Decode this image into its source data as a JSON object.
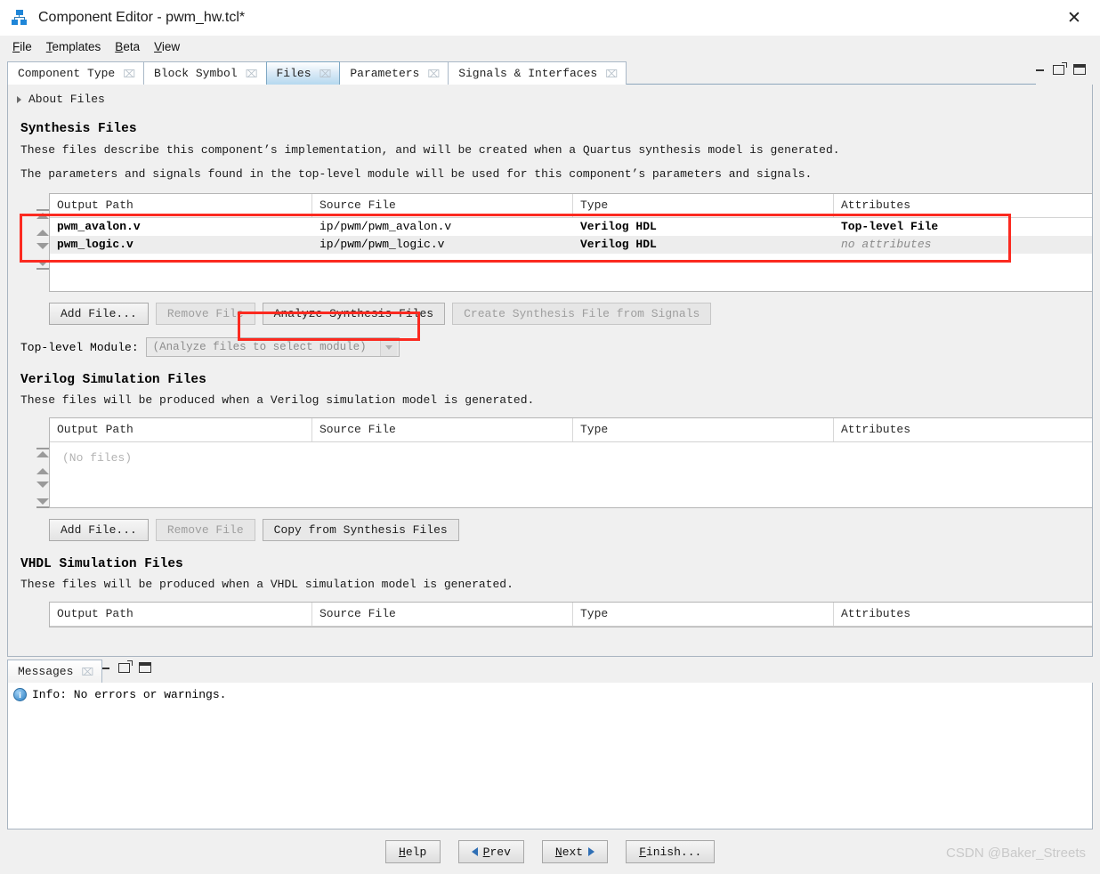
{
  "window": {
    "title": "Component Editor - pwm_hw.tcl*",
    "app_icon": "hierarchy-icon",
    "close_label": "✕"
  },
  "menubar": {
    "items": [
      {
        "pre": "F",
        "rest": "ile"
      },
      {
        "pre": "T",
        "rest": "emplates"
      },
      {
        "pre": "B",
        "rest": "eta"
      },
      {
        "pre": "V",
        "rest": "iew"
      }
    ]
  },
  "tabs": {
    "items": [
      {
        "label": "Component Type",
        "selected": false
      },
      {
        "label": "Block Symbol",
        "selected": false
      },
      {
        "label": "Files",
        "selected": true
      },
      {
        "label": "Parameters",
        "selected": false
      },
      {
        "label": "Signals & Interfaces",
        "selected": false
      }
    ],
    "close_glyph": "⌧",
    "panel_controls": [
      "minimize-icon",
      "float-icon",
      "restore-icon"
    ]
  },
  "about": {
    "label": "About Files",
    "expander": "chevron-right-icon"
  },
  "synthesis": {
    "title": "Synthesis Files",
    "desc1": "These files describe this component’s implementation, and will be created when a Quartus synthesis model is generated.",
    "desc2": "The parameters and signals found in the top-level module will be used for this component’s parameters and signals.",
    "columns": [
      "Output Path",
      "Source File",
      "Type",
      "Attributes"
    ],
    "rows": [
      {
        "output_path": "pwm_avalon.v",
        "source_file": "ip/pwm/pwm_avalon.v",
        "type": "Verilog HDL",
        "attributes": "Top-level File"
      },
      {
        "output_path": "pwm_logic.v",
        "source_file": "ip/pwm/pwm_logic.v",
        "type": "Verilog HDL",
        "attributes": "no attributes"
      }
    ],
    "buttons": [
      {
        "label": "Add File...",
        "enabled": true
      },
      {
        "label": "Remove File",
        "enabled": false
      },
      {
        "label": "Analyze Synthesis Files",
        "enabled": true,
        "highlighted": true
      },
      {
        "label": "Create Synthesis File from Signals",
        "enabled": false
      }
    ],
    "toplevel_label": "Top-level Module:",
    "toplevel_value": "(Analyze files to select module)"
  },
  "verilog_sim": {
    "title": "Verilog Simulation Files",
    "desc": "These files will be produced when a Verilog simulation model is generated.",
    "columns": [
      "Output Path",
      "Source File",
      "Type",
      "Attributes"
    ],
    "empty_text": "(No files)",
    "buttons": [
      {
        "label": "Add File...",
        "enabled": true
      },
      {
        "label": "Remove File",
        "enabled": false
      },
      {
        "label": "Copy from Synthesis Files",
        "enabled": true
      }
    ]
  },
  "vhdl_sim": {
    "title": "VHDL Simulation Files",
    "desc": "These files will be produced when a VHDL simulation model is generated.",
    "columns": [
      "Output Path",
      "Source File",
      "Type",
      "Attributes"
    ]
  },
  "messages": {
    "tab_label": "Messages",
    "close_glyph": "⌧",
    "info_glyph": "i",
    "text": "Info: No errors or warnings.",
    "panel_controls": [
      "minimize-icon",
      "float-icon",
      "restore-icon"
    ]
  },
  "footer": {
    "help": {
      "pre": "H",
      "rest": "elp"
    },
    "prev": {
      "pre": "P",
      "rest": "rev"
    },
    "next": {
      "pre": "N",
      "rest": "ext"
    },
    "finish": {
      "pre": "F",
      "rest": "inish..."
    }
  },
  "watermark": "CSDN @Baker_Streets",
  "colors": {
    "accent_tab": "#b5d8ef",
    "annotation_red": "#fb2a20",
    "info_blue": "#2a7fc4"
  }
}
